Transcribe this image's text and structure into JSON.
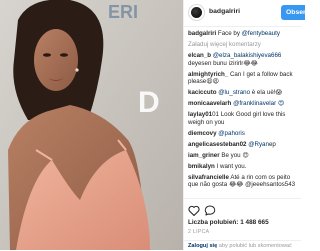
{
  "post": {
    "username": "badgalriri",
    "follow_label": "Obser",
    "caption_user": "badgalriri",
    "caption_text": " Face by ",
    "caption_mention": "@fentybeauty",
    "more_label": "Załaduj więcej komentarzy",
    "comments": [
      {
        "user": "elcan_b",
        "mention": "@elza_balakishiyeva666",
        "text": " deyesen bunu izirirlr😂😂"
      },
      {
        "user": "almightyrich_",
        "mention": "",
        "text": " Can I get a follow back please😩😩"
      },
      {
        "user": "kaciccuto",
        "mention": "@lu_strano",
        "text": " è ela uè!😱"
      },
      {
        "user": "monicaavelarh",
        "mention": "@franklinavelar 😍",
        "text": ""
      },
      {
        "user": "laylay01",
        "mention": "",
        "text": "01 Look Good girl love this weigh on you"
      },
      {
        "user": "diemcovy",
        "mention": "@pahoris",
        "text": ""
      },
      {
        "user": "angelicasesteban02",
        "mention": "@Ryan",
        "text": "ep"
      },
      {
        "user": "iam_griner",
        "mention": "",
        "text": " Be you 😍"
      },
      {
        "user": "bmikalyn",
        "mention": "",
        "text": " I want you."
      },
      {
        "user": "silvafrancielle",
        "mention": "",
        "text": " Até a rin com os peito que não gosta 😂😂 @jeeehsantos543"
      }
    ],
    "likes_label": "Liczba polubień: 1 488 665",
    "date": "2 LIPCA",
    "footer_login": "Zaloguj się",
    "footer_text": " aby polubić lub skomentować"
  },
  "icons": {
    "like": "heart-outline-icon",
    "comment": "speech-bubble-icon"
  },
  "colors": {
    "follow_button": "#3897f0",
    "link": "#003569",
    "muted": "#999999"
  }
}
